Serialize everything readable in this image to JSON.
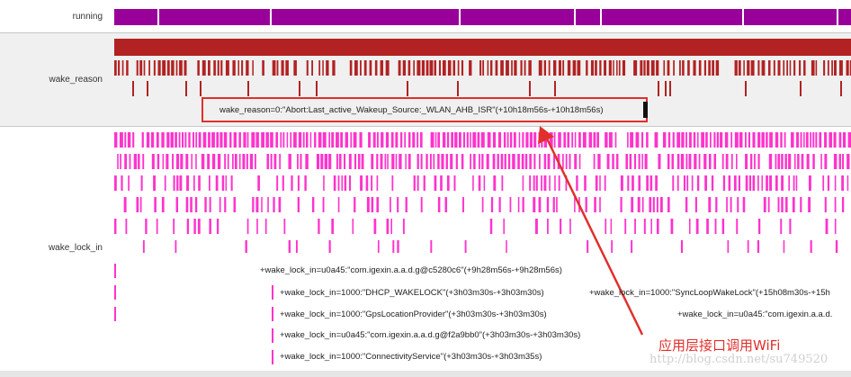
{
  "rows": {
    "running": "running",
    "wake_reason": "wake_reason",
    "wake_lock_in": "wake_lock_in"
  },
  "tooltip": "wake_reason=0:\"Abort:Last_active_Wakeup_Source:_WLAN_AHB_ISR\"(+10h18m56s-+10h18m56s)",
  "events": [
    "+wake_lock_in=u0a45:\"com.igexin.a.a.d.g@c5280c6\"(+9h28m56s-+9h28m56s)",
    "+wake_lock_in=1000:\"DHCP_WAKELOCK\"(+3h03m30s-+3h03m30s)",
    "+wake_lock_in=1000:\"SyncLoopWakeLock\"(+15h08m30s-+15h",
    "+wake_lock_in=1000:\"GpsLocationProvider\"(+3h03m30s-+3h03m30s)",
    "+wake_lock_in=u0a45:\"com.igexin.a.a.d.",
    "+wake_lock_in=u0a45:\"com.igexin.a.a.d.g@f2a9bb0\"(+3h03m30s-+3h03m30s)",
    "+wake_lock_in=1000:\"ConnectivityService\"(+3h03m30s-+3h03m35s)"
  ],
  "annotation": "应用层接口调用WiFi",
  "watermark": "http://blog.csdn.net/su749520",
  "colors": {
    "running": "#990099",
    "wake_reason": "#b22222",
    "wake_lock": "#ff33cc",
    "callout": "#e0302c"
  }
}
